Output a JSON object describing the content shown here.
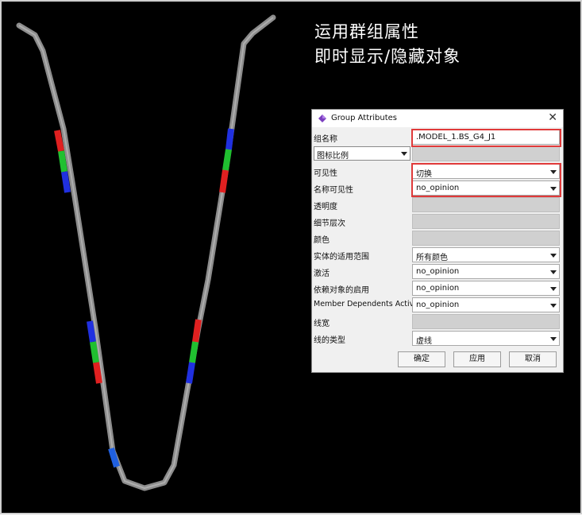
{
  "heading": {
    "line1": "运用群组属性",
    "line2": "即时显示/隐藏对象"
  },
  "dialog": {
    "title": "Group Attributes",
    "rows": [
      {
        "label": "组名称",
        "value": ".MODEL_1.BS_G4_J1"
      },
      {
        "label": "图标比例",
        "value": ""
      },
      {
        "label": "可见性",
        "value": "切换"
      },
      {
        "label": "名称可见性",
        "value": "no_opinion"
      },
      {
        "label": "透明度",
        "value": ""
      },
      {
        "label": "细节层次",
        "value": ""
      },
      {
        "label": "颜色",
        "value": ""
      },
      {
        "label": "实体的适用范围",
        "value": "所有颜色"
      },
      {
        "label": "激活",
        "value": "no_opinion"
      },
      {
        "label": "依赖对象的启用",
        "value": "no_opinion"
      },
      {
        "label": "Member Dependents Active",
        "value": "no_opinion"
      },
      {
        "label": "线宽",
        "value": ""
      },
      {
        "label": "线的类型",
        "value": "虚线"
      }
    ],
    "buttons": {
      "ok": "确定",
      "apply": "应用",
      "cancel": "取消"
    }
  },
  "colors": {
    "background": "#000000",
    "highlight": "#e03a3a",
    "band_red": "#e02020",
    "band_green": "#20c030",
    "band_blue": "#2030e0"
  }
}
